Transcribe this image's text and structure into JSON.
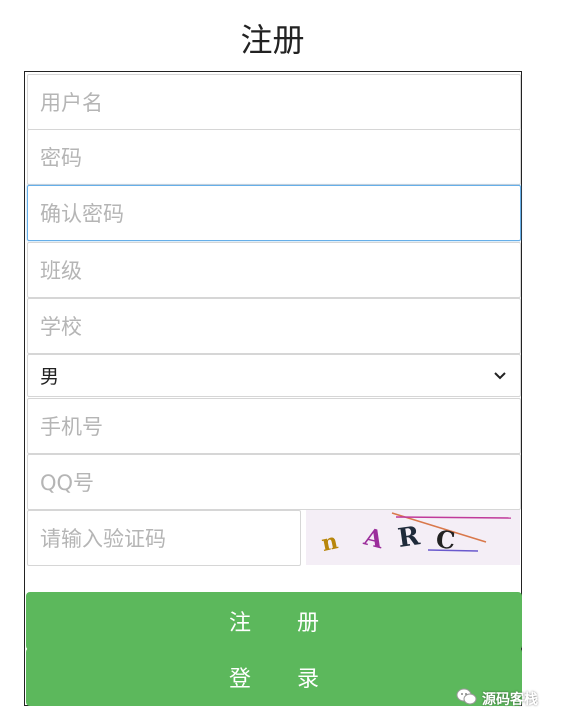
{
  "page": {
    "title": "注册"
  },
  "form": {
    "username_placeholder": "用户名",
    "password_placeholder": "密码",
    "confirm_password_placeholder": "确认密码",
    "class_placeholder": "班级",
    "school_placeholder": "学校",
    "gender": {
      "selected": "男"
    },
    "phone_placeholder": "手机号",
    "qq_placeholder": "QQ号",
    "captcha_placeholder": "请输入验证码",
    "captcha_chars": [
      "n",
      "A",
      "R",
      "C"
    ]
  },
  "buttons": {
    "register_label": "注 册",
    "login_label": "登 录"
  },
  "watermark": {
    "text": "源码客栈",
    "icon": "wechat-icon"
  },
  "colors": {
    "button": "#5cb85c",
    "focus_border": "#66afe9",
    "border": "#d6d6d6",
    "captcha_bg": "#f4eef6"
  }
}
